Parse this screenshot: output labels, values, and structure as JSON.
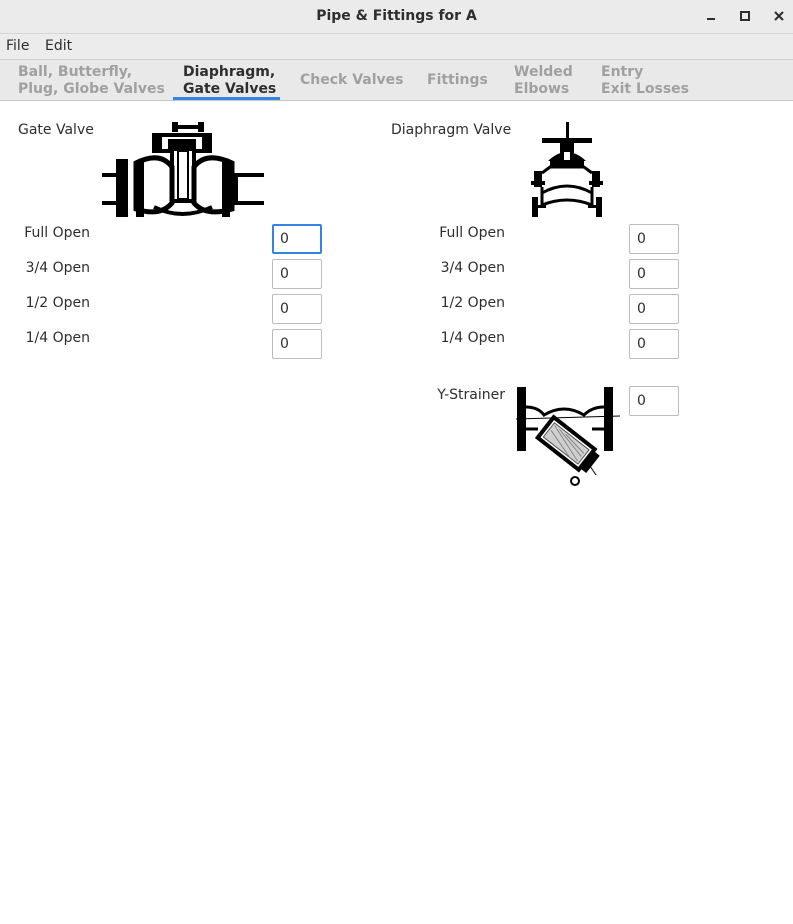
{
  "window": {
    "title": "Pipe & Fittings for A"
  },
  "menu": {
    "file": "File",
    "edit": "Edit"
  },
  "tabs": [
    {
      "line1": "Ball, Butterfly,",
      "line2": "Plug, Globe Valves",
      "active": false
    },
    {
      "line1": "Diaphragm,",
      "line2": "Gate Valves",
      "active": true
    },
    {
      "line1": "Check Valves",
      "line2": "",
      "active": false
    },
    {
      "line1": "Fittings",
      "line2": "",
      "active": false
    },
    {
      "line1": "Welded",
      "line2": "Elbows",
      "active": false
    },
    {
      "line1": "Entry",
      "line2": "Exit Losses",
      "active": false
    }
  ],
  "gate_valve": {
    "title": "Gate Valve",
    "rows": [
      {
        "label": "Full Open",
        "value": "0"
      },
      {
        "label": "3/4 Open",
        "value": "0"
      },
      {
        "label": "1/2 Open",
        "value": "0"
      },
      {
        "label": "1/4 Open",
        "value": "0"
      }
    ]
  },
  "diaphragm_valve": {
    "title": "Diaphragm Valve",
    "rows": [
      {
        "label": "Full Open",
        "value": "0"
      },
      {
        "label": "3/4 Open",
        "value": "0"
      },
      {
        "label": "1/2 Open",
        "value": "0"
      },
      {
        "label": "1/4 Open",
        "value": "0"
      }
    ]
  },
  "y_strainer": {
    "label": "Y-Strainer",
    "value": "0"
  },
  "icons": {
    "minimize": "minimize-icon",
    "maximize": "maximize-icon",
    "close": "close-icon"
  }
}
